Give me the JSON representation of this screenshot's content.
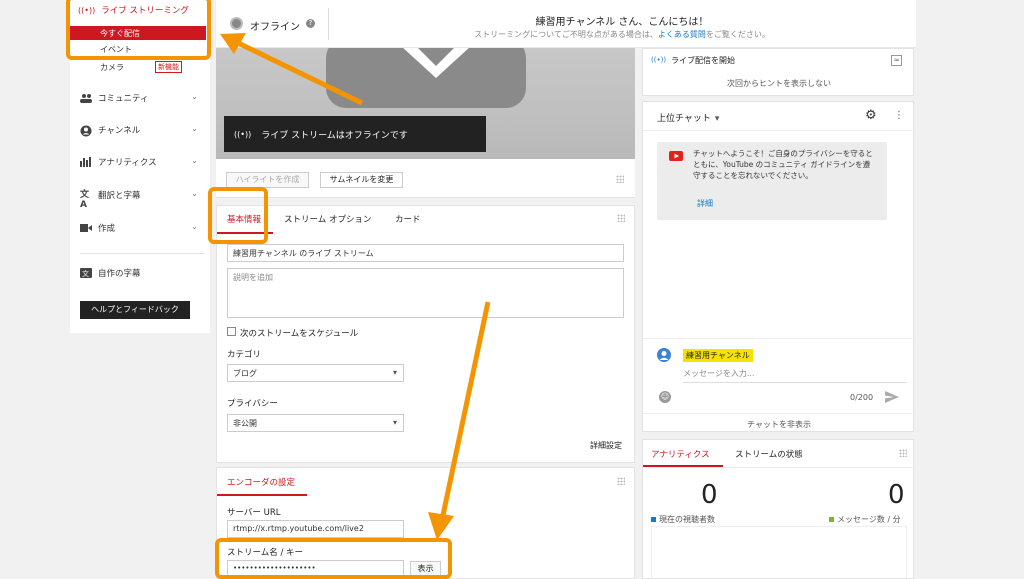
{
  "sidebar": {
    "live_streaming": "ライブ ストリーミング",
    "now_streaming": "今すぐ配信",
    "events": "イベント",
    "camera": "カメラ",
    "new_badge": "新機能",
    "items": [
      {
        "label": "コミュニティ"
      },
      {
        "label": "チャンネル"
      },
      {
        "label": "アナリティクス"
      },
      {
        "label": "翻訳と字幕"
      },
      {
        "label": "作成"
      },
      {
        "label": "自作の字幕"
      }
    ],
    "help_button": "ヘルプとフィードバック"
  },
  "topbar": {
    "status": "オフライン",
    "greeting": "練習用チャンネル さん、こんにちは！",
    "sub_text": "ストリーミングについてご不明な点がある場合は、",
    "faq_link": "よくある質問",
    "sub_text_end": "をご覧ください。"
  },
  "preview": {
    "offline_text": "ライブ ストリームはオフラインです",
    "highlight_button": "ハイライトを作成",
    "thumbnail_button": "サムネイルを変更"
  },
  "info": {
    "tabs": [
      "基本情報",
      "ストリーム オプション",
      "カード"
    ],
    "title_value": "練習用チャンネル のライブ ストリーム",
    "description_placeholder": "説明を追加",
    "schedule_label": "次のストリームをスケジュール",
    "category_label": "カテゴリ",
    "category_value": "ブログ",
    "privacy_label": "プライバシー",
    "privacy_value": "非公開",
    "advanced_link": "詳細設定"
  },
  "encoder": {
    "title": "エンコーダの設定",
    "server_label": "サーバー URL",
    "server_value": "rtmp://x.rtmp.youtube.com/live2",
    "key_label": "ストリーム名 / キー",
    "key_value": "••••••••••••••••••••",
    "show_button": "表示"
  },
  "hint": {
    "start_label": "ライブ配信を開始",
    "dismiss": "次回からヒントを表示しない"
  },
  "chat": {
    "mode": "上位チャット",
    "welcome": "チャットへようこそ！ご自身のプライバシーを守るとともに、YouTube のコミュニティ ガイドラインを遵守することを忘れないでください。",
    "details_link": "詳細",
    "user_name": "練習用チャンネル",
    "message_placeholder": "メッセージを入力...",
    "counter": "0/200",
    "hide_chat": "チャットを非表示"
  },
  "analytics": {
    "tabs": [
      "アナリティクス",
      "ストリームの状態"
    ],
    "viewers_value": "0",
    "viewers_label": "現在の視聴者数",
    "messages_value": "0",
    "messages_label": "メッセージ数 / 分"
  },
  "colors": {
    "accent_red": "#cc181e",
    "orange_annotation": "#f49400",
    "link_blue": "#167ac6"
  }
}
